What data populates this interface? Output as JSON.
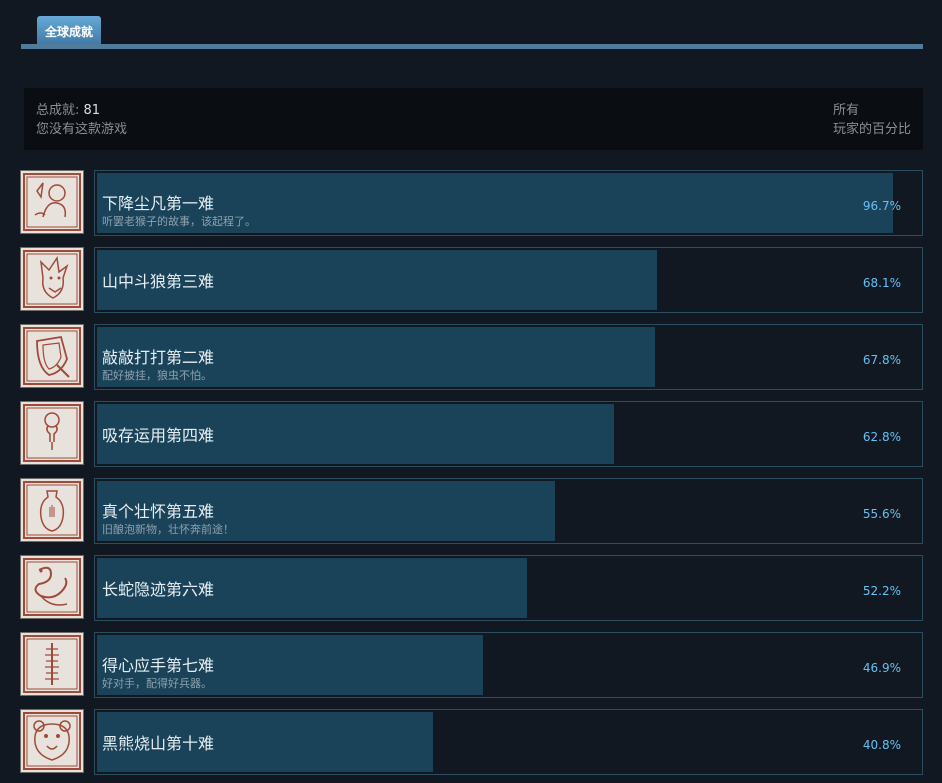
{
  "tab": {
    "label": "全球成就"
  },
  "summary": {
    "total_label": "总成就:",
    "total_count": "81",
    "ownership_note": "您没有这款游戏",
    "column_label_line1": "所有",
    "column_label_line2": "玩家的百分比"
  },
  "achievements": [
    {
      "title": "下降尘凡第一难",
      "desc": "听罢老猴子的故事，该起程了。",
      "percent_label": "96.7%",
      "percent": 96.7,
      "icon": "monkey-icon"
    },
    {
      "title": "山中斗狼第三难",
      "desc": "",
      "percent_label": "68.1%",
      "percent": 68.1,
      "icon": "wolf-icon"
    },
    {
      "title": "敲敲打打第二难",
      "desc": "配好披挂，狼虫不怕。",
      "percent_label": "67.8%",
      "percent": 67.8,
      "icon": "shield-icon"
    },
    {
      "title": "吸存运用第四难",
      "desc": "",
      "percent_label": "62.8%",
      "percent": 62.8,
      "icon": "gourd-icon"
    },
    {
      "title": "真个壮怀第五难",
      "desc": "旧酿泡新物，壮怀奔前途！",
      "percent_label": "55.6%",
      "percent": 55.6,
      "icon": "vase-icon"
    },
    {
      "title": "长蛇隐迹第六难",
      "desc": "",
      "percent_label": "52.2%",
      "percent": 52.2,
      "icon": "snake-icon"
    },
    {
      "title": "得心应手第七难",
      "desc": "好对手，配得好兵器。",
      "percent_label": "46.9%",
      "percent": 46.9,
      "icon": "staff-icon"
    },
    {
      "title": "黑熊烧山第十难",
      "desc": "",
      "percent_label": "40.8%",
      "percent": 40.8,
      "icon": "bear-icon"
    }
  ],
  "colors": {
    "background": "#111821",
    "bar_fill": "#1a4359",
    "percent_text": "#66c0f4",
    "icon_line": "#a04a3a"
  }
}
